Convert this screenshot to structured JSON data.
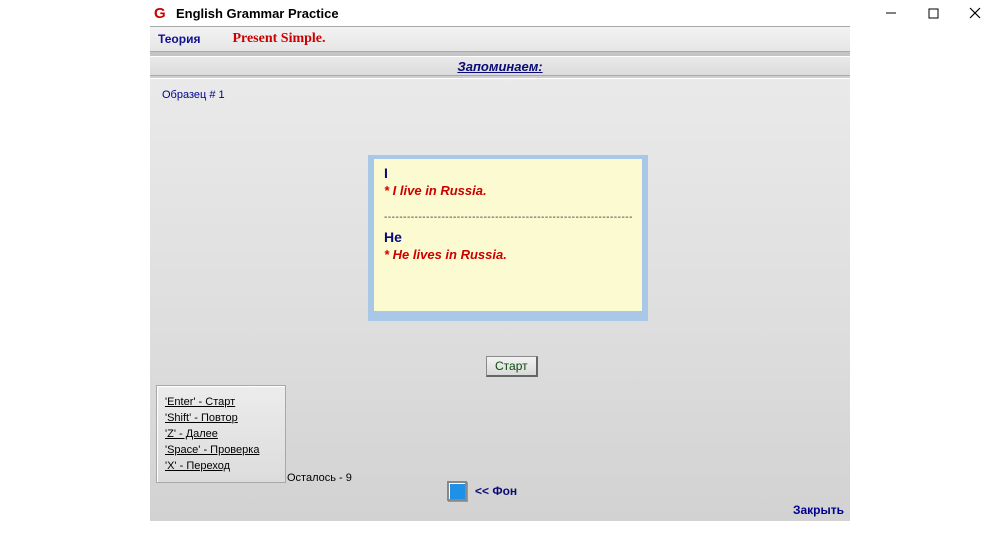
{
  "window": {
    "title": "English Grammar Practice",
    "icon_glyph": "G"
  },
  "header": {
    "theory": "Теория",
    "lesson_title": "Present Simple."
  },
  "section_title": "Запоминаем:",
  "sample_label": "Образец # 1",
  "card": {
    "pronoun1": "I",
    "sentence1": "* I live in Russia.",
    "separator": "------------------------------------------------------------------------",
    "pronoun2": "He",
    "sentence2": "* He lives in Russia."
  },
  "start_button": "Старт",
  "hints": [
    "'Enter' - Старт",
    "'Shift' - Повтор",
    "'Z' - Далее",
    "'Space' - Проверка",
    "'X' - Переход"
  ],
  "remaining": "Осталось - 9",
  "bg_label": "<< Фон",
  "bg_color": "#1e90e8",
  "close_button": "Закрыть"
}
